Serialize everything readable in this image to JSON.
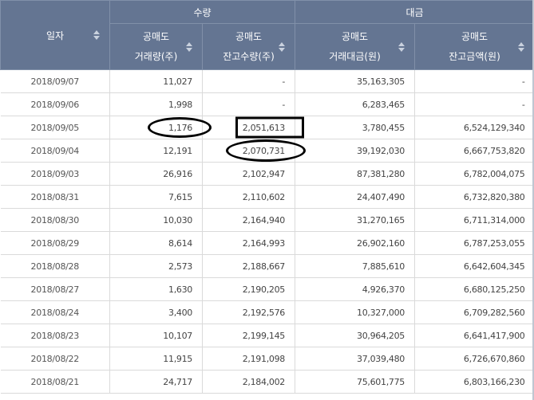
{
  "header": {
    "date_label": "일자",
    "group_volume": "수량",
    "group_amount": "대금",
    "col1_line1": "공매도",
    "col1_line2": "거래량(주)",
    "col2_line1": "공매도",
    "col2_line2": "잔고수량(주)",
    "col3_line1": "공매도",
    "col3_line2": "거래대금(원)",
    "col4_line1": "공매도",
    "col4_line2": "잔고금액(원)"
  },
  "rows": [
    {
      "date": "2018/09/07",
      "vol": "11,027",
      "bal": "-",
      "amt": "35,163,305",
      "balamt": "-"
    },
    {
      "date": "2018/09/06",
      "vol": "1,998",
      "bal": "-",
      "amt": "6,283,465",
      "balamt": "-"
    },
    {
      "date": "2018/09/05",
      "vol": "1,176",
      "bal": "2,051,613",
      "amt": "3,780,455",
      "balamt": "6,524,129,340"
    },
    {
      "date": "2018/09/04",
      "vol": "12,191",
      "bal": "2,070,731",
      "amt": "39,192,030",
      "balamt": "6,667,753,820"
    },
    {
      "date": "2018/09/03",
      "vol": "26,916",
      "bal": "2,102,947",
      "amt": "87,381,280",
      "balamt": "6,782,004,075"
    },
    {
      "date": "2018/08/31",
      "vol": "7,615",
      "bal": "2,110,602",
      "amt": "24,407,490",
      "balamt": "6,732,820,380"
    },
    {
      "date": "2018/08/30",
      "vol": "10,030",
      "bal": "2,164,940",
      "amt": "31,270,165",
      "balamt": "6,711,314,000"
    },
    {
      "date": "2018/08/29",
      "vol": "8,614",
      "bal": "2,164,993",
      "amt": "26,902,160",
      "balamt": "6,787,253,055"
    },
    {
      "date": "2018/08/28",
      "vol": "2,573",
      "bal": "2,188,667",
      "amt": "7,885,610",
      "balamt": "6,642,604,345"
    },
    {
      "date": "2018/08/27",
      "vol": "1,630",
      "bal": "2,190,205",
      "amt": "4,926,370",
      "balamt": "6,680,125,250"
    },
    {
      "date": "2018/08/24",
      "vol": "3,400",
      "bal": "2,192,576",
      "amt": "10,327,000",
      "balamt": "6,709,282,560"
    },
    {
      "date": "2018/08/23",
      "vol": "10,107",
      "bal": "2,199,145",
      "amt": "30,964,205",
      "balamt": "6,641,417,900"
    },
    {
      "date": "2018/08/22",
      "vol": "11,915",
      "bal": "2,191,098",
      "amt": "37,039,480",
      "balamt": "6,726,670,860"
    },
    {
      "date": "2018/08/21",
      "vol": "24,717",
      "bal": "2,184,002",
      "amt": "75,601,775",
      "balamt": "6,803,166,230"
    }
  ]
}
